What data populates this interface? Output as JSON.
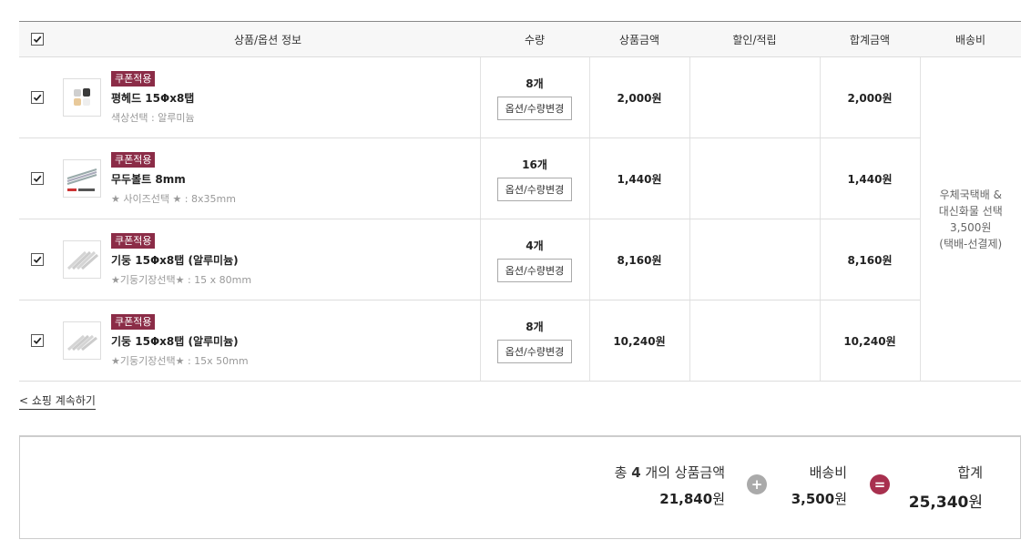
{
  "header": {
    "product_info": "상품/옵션 정보",
    "quantity": "수량",
    "product_price": "상품금액",
    "discount": "할인/적립",
    "total": "합계금액",
    "shipping": "배송비"
  },
  "items": [
    {
      "coupon": "쿠폰적용",
      "name": "평헤드 15Φx8탭",
      "option": "색상선택 : 알루미늄",
      "qty": "8개",
      "price": "2,000원",
      "discount": "",
      "total": "2,000원",
      "thumb": "cap-parts"
    },
    {
      "coupon": "쿠폰적용",
      "name": "무두볼트 8mm",
      "option": "★ 사이즈선택 ★ : 8x35mm",
      "qty": "16개",
      "price": "1,440원",
      "discount": "",
      "total": "1,440원",
      "thumb": "bolts"
    },
    {
      "coupon": "쿠폰적용",
      "name": "기둥 15Φx8탭 (알루미늄)",
      "option": "★기둥기장선택★ : 15 x 80mm",
      "qty": "4개",
      "price": "8,160원",
      "discount": "",
      "total": "8,160원",
      "thumb": "rods"
    },
    {
      "coupon": "쿠폰적용",
      "name": "기둥 15Φx8탭 (알루미늄)",
      "option": "★기둥기장선택★ : 15x 50mm",
      "qty": "8개",
      "price": "10,240원",
      "discount": "",
      "total": "10,240원",
      "thumb": "rods"
    }
  ],
  "option_button_label": "옵션/수량변경",
  "shipping_info": [
    "우체국택배 &",
    "대신화물 선택",
    "3,500원",
    "(택배-선결제)"
  ],
  "continue_label": "< 쇼핑 계속하기",
  "summary": {
    "products_prefix": "총 ",
    "products_count": "4",
    "products_suffix": " 개의 상품금액",
    "products_amount": "21,840",
    "shipping_label": "배송비",
    "shipping_amount": "3,500",
    "total_label": "합계",
    "total_amount": "25,340",
    "unit": "원",
    "plus": "+",
    "equals": "="
  },
  "colors": {
    "coupon": "#8b2c47",
    "plus": "#aaaaaa",
    "equals": "#a8304f"
  }
}
